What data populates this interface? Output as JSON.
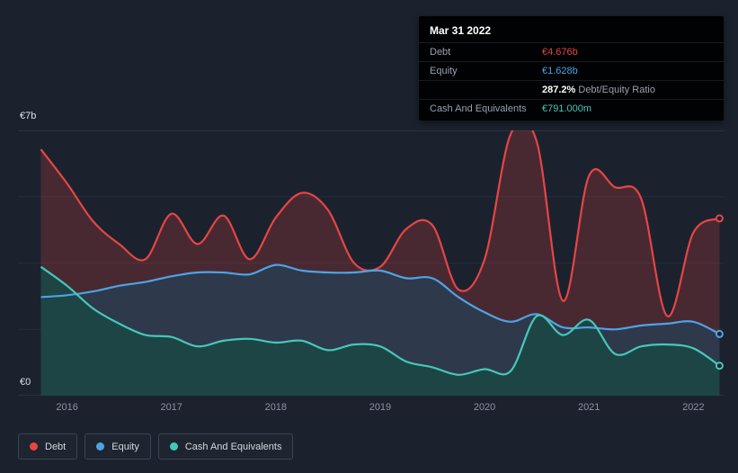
{
  "page": {
    "background": "#1b222d"
  },
  "axis": {
    "y_top": "€7b",
    "y_bottom": "€0"
  },
  "tooltip": {
    "date": "Mar 31 2022",
    "debt_label": "Debt",
    "debt_value": "€4.676b",
    "equity_label": "Equity",
    "equity_value": "€1.628b",
    "ratio_value": "287.2%",
    "ratio_label": "Debt/Equity Ratio",
    "cash_label": "Cash And Equivalents",
    "cash_value": "€791.000m"
  },
  "legend": {
    "items": [
      {
        "label": "Debt"
      },
      {
        "label": "Equity"
      },
      {
        "label": "Cash And Equivalents"
      }
    ]
  },
  "chart_data": {
    "type": "area",
    "unit": "€ billions",
    "ylim": [
      0,
      7
    ],
    "x_range": [
      2015.53,
      2022.29
    ],
    "x_ticks": [
      2016,
      2017,
      2018,
      2019,
      2020,
      2021,
      2022
    ],
    "gridlines": [
      0,
      1.75,
      3.5,
      5.25,
      7
    ],
    "legend_position": "bottom-left",
    "x": [
      2015.75,
      2016.0,
      2016.25,
      2016.5,
      2016.75,
      2017.0,
      2017.25,
      2017.5,
      2017.75,
      2018.0,
      2018.25,
      2018.5,
      2018.75,
      2019.0,
      2019.25,
      2019.5,
      2019.75,
      2020.0,
      2020.25,
      2020.5,
      2020.75,
      2021.0,
      2021.25,
      2021.5,
      2021.75,
      2022.0,
      2022.25
    ],
    "series": [
      {
        "name": "Debt",
        "color": "#e64545",
        "fill": "rgba(230,69,69,0.22)",
        "values": [
          6.5,
          5.6,
          4.6,
          4.0,
          3.6,
          4.8,
          4.0,
          4.75,
          3.6,
          4.7,
          5.35,
          4.9,
          3.5,
          3.4,
          4.4,
          4.5,
          2.8,
          3.6,
          6.9,
          6.7,
          2.5,
          5.8,
          5.5,
          5.2,
          2.1,
          4.3,
          4.676
        ]
      },
      {
        "name": "Equity",
        "color": "#4ea3e6",
        "fill": "rgba(44,58,78,0.93)",
        "values": [
          2.6,
          2.65,
          2.75,
          2.9,
          3.0,
          3.15,
          3.25,
          3.25,
          3.2,
          3.45,
          3.3,
          3.25,
          3.25,
          3.3,
          3.1,
          3.1,
          2.6,
          2.2,
          1.95,
          2.15,
          1.8,
          1.8,
          1.75,
          1.85,
          1.9,
          1.95,
          1.628
        ]
      },
      {
        "name": "Cash And Equivalents",
        "color": "#45c8b8",
        "fill": "rgba(30,70,70,0.95)",
        "values": [
          3.4,
          2.9,
          2.3,
          1.9,
          1.6,
          1.55,
          1.3,
          1.45,
          1.5,
          1.4,
          1.45,
          1.2,
          1.35,
          1.3,
          0.9,
          0.75,
          0.55,
          0.7,
          0.65,
          2.1,
          1.6,
          2.0,
          1.1,
          1.3,
          1.35,
          1.25,
          0.791
        ]
      }
    ]
  }
}
